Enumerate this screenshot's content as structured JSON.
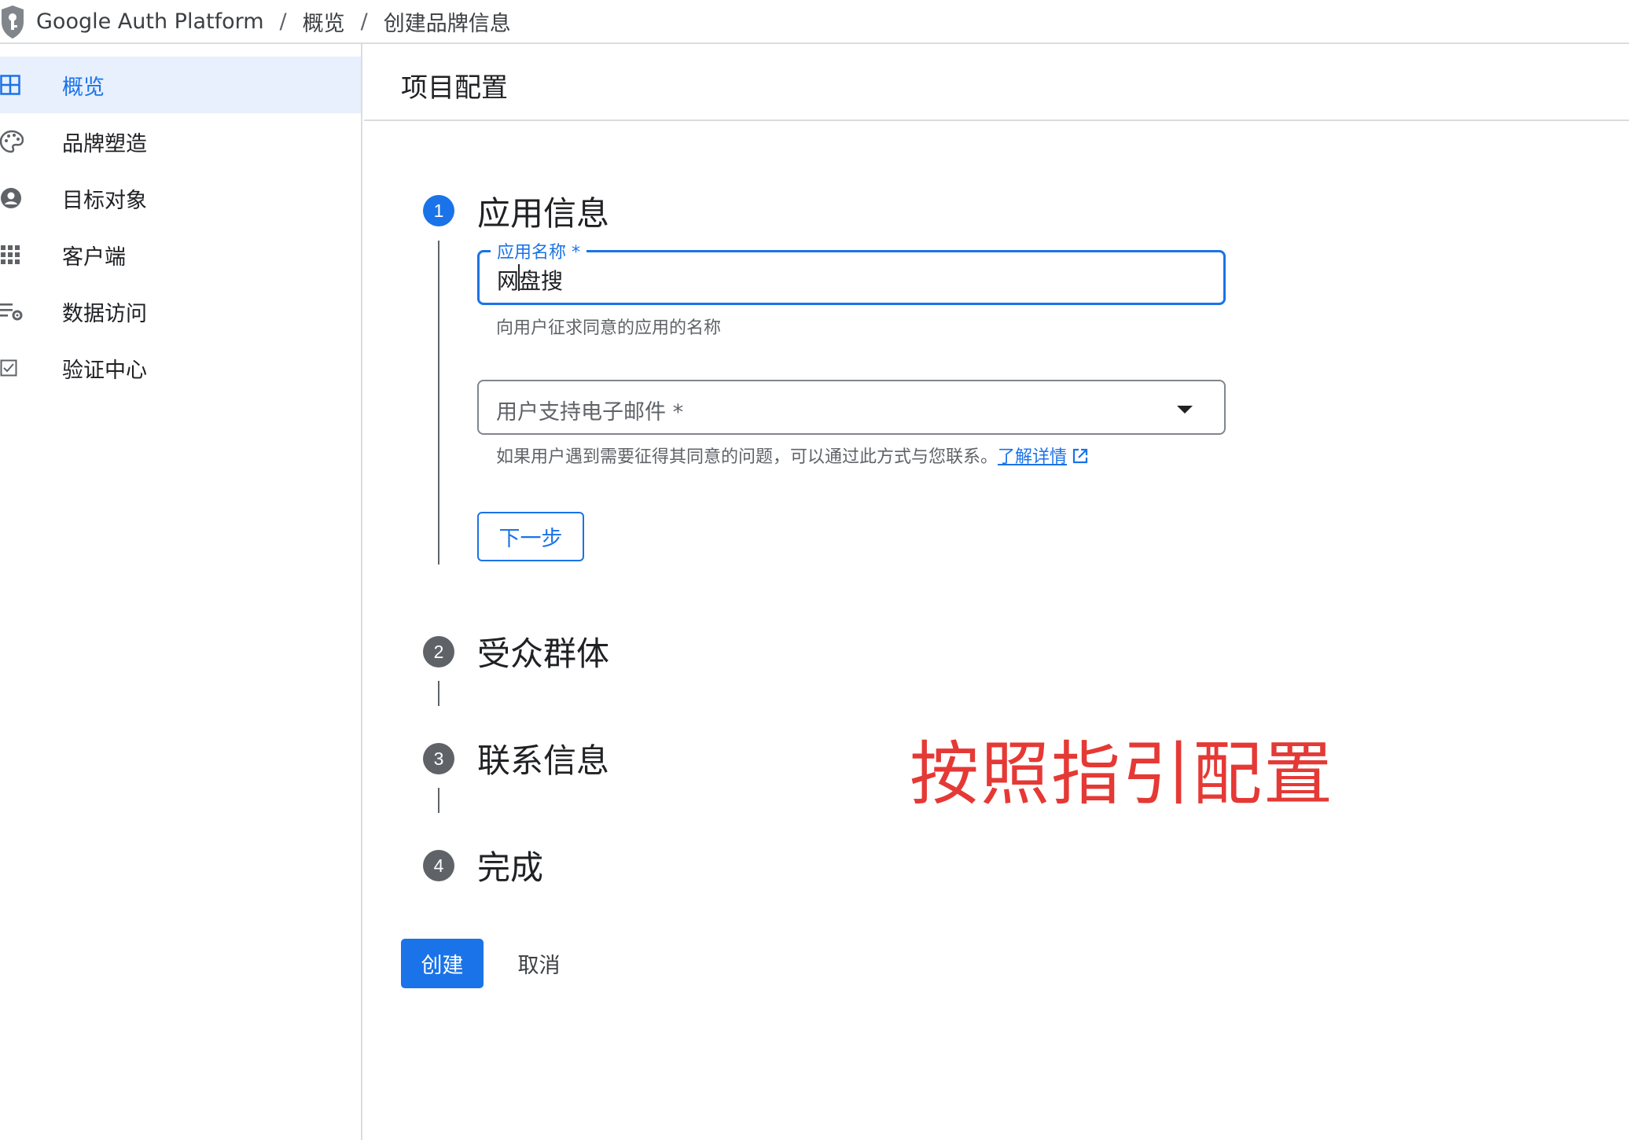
{
  "breadcrumb": {
    "app": "Google Auth Platform",
    "separator": "/",
    "overview": "概览",
    "current": "创建品牌信息"
  },
  "sidebar": {
    "items": [
      {
        "label": "概览",
        "icon": "dashboard-icon",
        "active": true
      },
      {
        "label": "品牌塑造",
        "icon": "palette-icon",
        "active": false
      },
      {
        "label": "目标对象",
        "icon": "account-circle-icon",
        "active": false
      },
      {
        "label": "客户端",
        "icon": "apps-grid-icon",
        "active": false
      },
      {
        "label": "数据访问",
        "icon": "data-settings-icon",
        "active": false
      },
      {
        "label": "验证中心",
        "icon": "checkbox-icon",
        "active": false
      }
    ]
  },
  "page": {
    "title": "项目配置"
  },
  "steps": [
    {
      "number": "1",
      "title": "应用信息",
      "state": "current"
    },
    {
      "number": "2",
      "title": "受众群体",
      "state": "pending"
    },
    {
      "number": "3",
      "title": "联系信息",
      "state": "pending"
    },
    {
      "number": "4",
      "title": "完成",
      "state": "pending"
    }
  ],
  "form": {
    "app_name_label": "应用名称 *",
    "app_name_value": "网盘搜",
    "app_name_hint": "向用户征求同意的应用的名称",
    "support_email_label": "用户支持电子邮件 *",
    "support_email_hint": "如果用户遇到需要征得其同意的问题，可以通过此方式与您联系。",
    "learn_more": "了解详情",
    "next_button": "下一步"
  },
  "actions": {
    "create": "创建",
    "cancel": "取消"
  },
  "annotation": "按照指引配置",
  "colors": {
    "accent": "#1a73e8",
    "annotation": "#e53935",
    "pending_step": "#5f6368"
  }
}
